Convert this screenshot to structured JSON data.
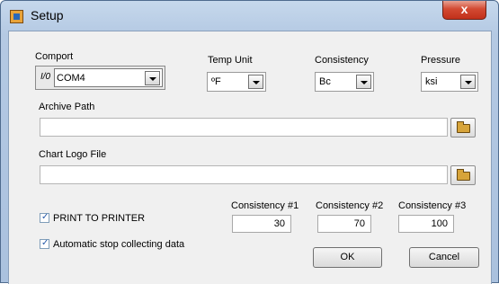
{
  "window": {
    "title": "Setup",
    "close_glyph": "x"
  },
  "comport": {
    "label": "Comport",
    "io_glyph": "I/0",
    "value": "COM4"
  },
  "temp_unit": {
    "label": "Temp Unit",
    "value": "ºF"
  },
  "consistency": {
    "label": "Consistency",
    "value": "Bc"
  },
  "pressure": {
    "label": "Pressure",
    "value": "ksi"
  },
  "archive_path": {
    "label": "Archive Path",
    "value": ""
  },
  "chart_logo_file": {
    "label": "Chart Logo File",
    "value": ""
  },
  "print_to_printer": {
    "label": "PRINT TO PRINTER",
    "checked": true
  },
  "auto_stop": {
    "label": "Automatic stop collecting data",
    "checked": true
  },
  "consistency_thresholds": [
    {
      "label": "Consistency #1",
      "value": "30"
    },
    {
      "label": "Consistency #2",
      "value": "70"
    },
    {
      "label": "Consistency #3",
      "value": "100"
    }
  ],
  "buttons": {
    "ok": "OK",
    "cancel": "Cancel"
  }
}
